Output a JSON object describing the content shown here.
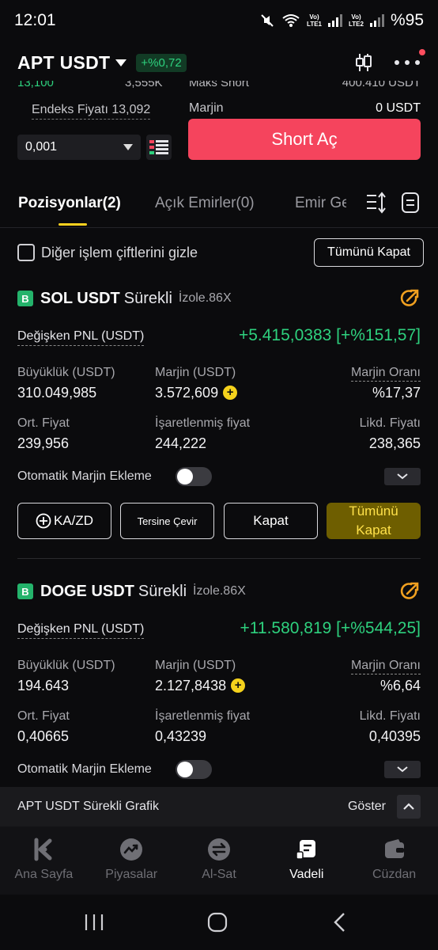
{
  "status": {
    "time": "12:01",
    "battery": "%95",
    "sim1": "LTE1",
    "sim2": "LTE2",
    "volte": "Vo)",
    "wifi_gen": "6"
  },
  "header": {
    "pair": "APT USDT",
    "change": "+%0,72"
  },
  "trade": {
    "cut_left": "13,100",
    "cut_mid": "3,555K",
    "cut_right_label": "Maks Short",
    "cut_right_value": "400.410 USDT",
    "index_price": "Endeks Fiyatı 13,092",
    "margin_label": "Marjin",
    "margin_value": "0 USDT",
    "qty": "0,001",
    "short_button": "Short Aç"
  },
  "tabs": {
    "positions": "Pozisyonlar(2)",
    "open_orders": "Açık Emirler(0)",
    "order_history": "Emir Geçmişi"
  },
  "filter": {
    "hide_others": "Diğer işlem çiftlerini gizle",
    "close_all": "Tümünü Kapat"
  },
  "labels": {
    "pnl": "Değişken PNL (USDT)",
    "size": "Büyüklük (USDT)",
    "margin": "Marjin (USDT)",
    "margin_ratio": "Marjin Oranı",
    "avg_price": "Ort. Fiyat",
    "mark_price": "İşaretlenmiş fiyat",
    "liq_price": "Likd. Fiyatı",
    "auto_margin": "Otomatik Marjin Ekleme",
    "ka_zd": "KA/ZD",
    "reverse": "Tersine Çevir",
    "close": "Kapat",
    "close_all_line1": "Tümünü",
    "close_all_line2": "Kapat"
  },
  "positions": [
    {
      "badge": "B",
      "symbol": "SOL USDT",
      "type": "Sürekli",
      "mode": "İzole.86X",
      "pnl": "+5.415,0383 [+%151,57]",
      "size": "310.049,985",
      "margin": "3.572,609",
      "margin_ratio": "%17,37",
      "avg_price": "239,956",
      "mark_price": "244,222",
      "liq_price": "238,365"
    },
    {
      "badge": "B",
      "symbol": "DOGE USDT",
      "type": "Sürekli",
      "mode": "İzole.86X",
      "pnl": "+11.580,819 [+%544,25]",
      "size": "194.643",
      "margin": "2.127,8438",
      "margin_ratio": "%6,64",
      "avg_price": "0,40665",
      "mark_price": "0,43239",
      "liq_price": "0,40395"
    }
  ],
  "chart_strip": {
    "label": "APT USDT Sürekli Grafik",
    "show": "Göster"
  },
  "nav": {
    "home": "Ana Sayfa",
    "markets": "Piyasalar",
    "trade": "Al-Sat",
    "futures": "Vadeli",
    "wallet": "Cüzdan"
  },
  "colors": {
    "accent_yellow": "#ffd21f",
    "profit_green": "#2ed17e",
    "short_red": "#f5445d"
  }
}
